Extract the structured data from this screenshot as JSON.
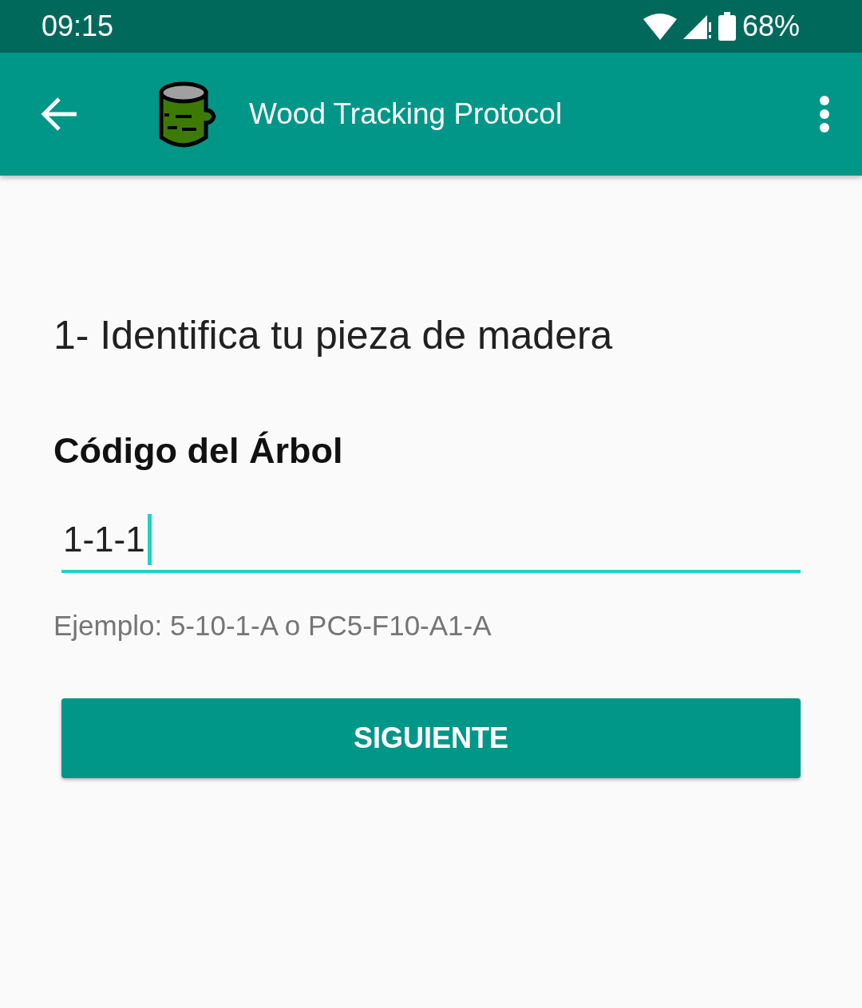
{
  "status_bar": {
    "time": "09:15",
    "battery": "68%"
  },
  "app_bar": {
    "title": "Wood Tracking Protocol"
  },
  "heading": "1- Identifica tu pieza de madera",
  "field": {
    "label": "Código del Árbol",
    "value": "1-1-1",
    "focused": true,
    "helper": "Ejemplo: 5-10-1-A o PC5-F10-A1-A"
  },
  "button": {
    "label": "SIGUIENTE"
  }
}
